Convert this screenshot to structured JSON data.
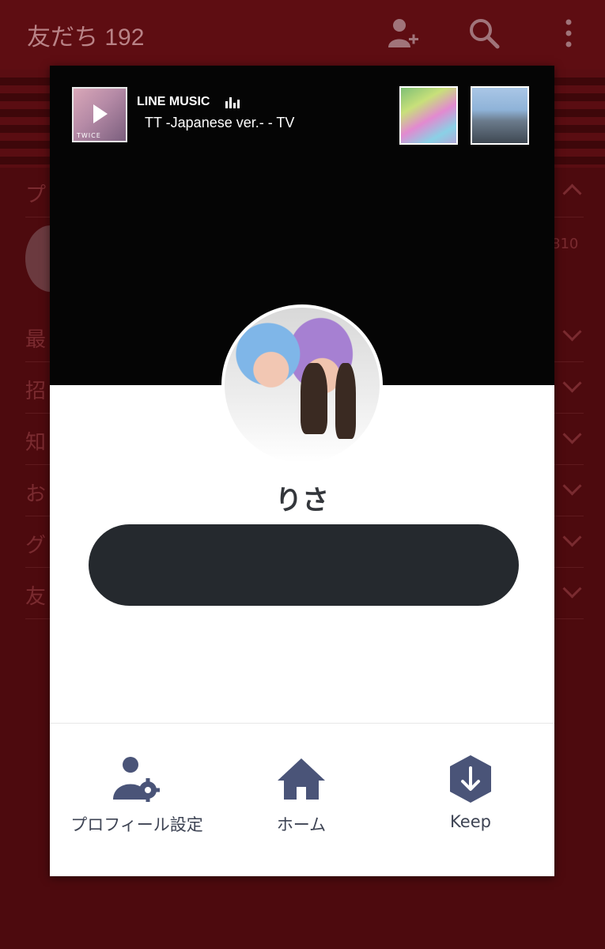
{
  "background": {
    "header_title": "友だち 192",
    "list_rows": [
      {
        "label": "プ",
        "chevron": "up"
      },
      {
        "label": "最",
        "chevron": "down"
      },
      {
        "label": "招",
        "chevron": "down"
      },
      {
        "label": "知",
        "chevron": "down"
      },
      {
        "label": "お",
        "chevron": "down"
      },
      {
        "label": "グ",
        "chevron": "down"
      },
      {
        "label": "友",
        "chevron": "down"
      }
    ],
    "side_number": "810",
    "icons": [
      "add-friend-icon",
      "search-icon",
      "more-vertical-icon"
    ]
  },
  "profile": {
    "music": {
      "service_label": "LINE MUSIC",
      "song": "TT -Japanese ver.- - TV",
      "album_text": "TWICE"
    },
    "name": "りさ",
    "status_message": ""
  },
  "actions": [
    {
      "label": "プロフィール設定",
      "icon": "profile-settings-icon"
    },
    {
      "label": "ホーム",
      "icon": "home-icon"
    },
    {
      "label": "Keep",
      "icon": "keep-icon"
    }
  ],
  "colors": {
    "accent": "#4a5478",
    "background_dim": "#4a0a0d",
    "status_bar": "#25292e"
  }
}
